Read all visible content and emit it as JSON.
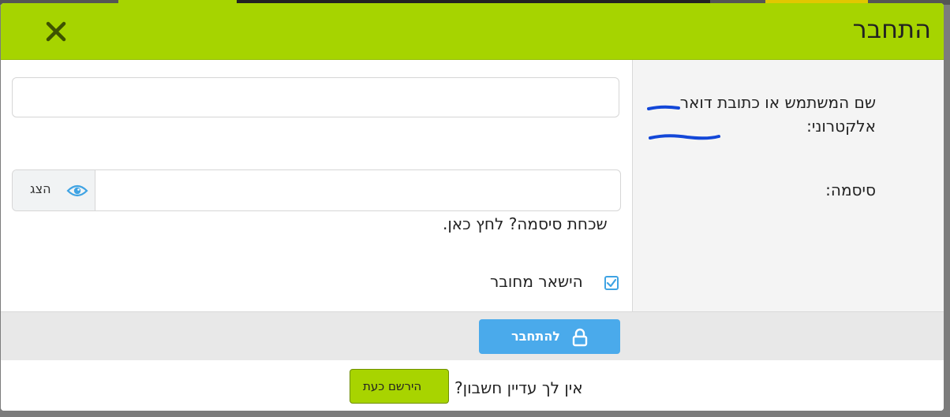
{
  "modal": {
    "title": "התחבר"
  },
  "form": {
    "username_label": "שם המשתמש או כתובת דואר אלקטרוני:",
    "username_value": "",
    "password_label": "סיסמה:",
    "password_value": "",
    "show_password_label": "הצג",
    "forgot_password": "שכחת סיסמה? לחץ כאן.",
    "remember_me": "הישאר מחובר",
    "remember_checked": true
  },
  "actions": {
    "login_label": "להתחבר"
  },
  "footer": {
    "no_account_text": "אין לך עדיין חשבון?",
    "register_label": "הירשם כעת"
  },
  "colors": {
    "header": "#a6d400",
    "login_button": "#4aaaeb",
    "register_button": "#a8d400",
    "annotation_ink": "#1347d8"
  },
  "icons": [
    "close-icon",
    "eye-icon",
    "checkbox-checked-icon",
    "lock-icon"
  ]
}
